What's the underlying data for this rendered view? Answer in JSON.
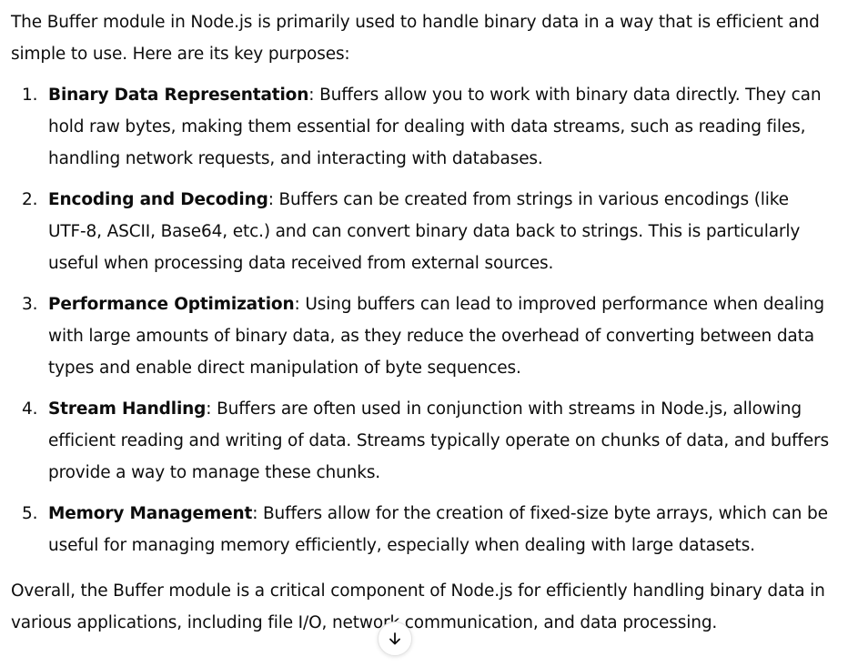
{
  "message": {
    "intro": "The Buffer module in Node.js is primarily used to handle binary data in a way that is efficient and simple to use. Here are its key purposes:",
    "items": [
      {
        "number": "1.",
        "title": "Binary Data Representation",
        "text": ": Buffers allow you to work with binary data directly. They can hold raw bytes, making them essential for dealing with data streams, such as reading files, handling network requests, and interacting with databases."
      },
      {
        "number": "2.",
        "title": "Encoding and Decoding",
        "text": ": Buffers can be created from strings in various encodings (like UTF-8, ASCII, Base64, etc.) and can convert binary data back to strings. This is particularly useful when processing data received from external sources."
      },
      {
        "number": "3.",
        "title": "Performance Optimization",
        "text": ": Using buffers can lead to improved performance when dealing with large amounts of binary data, as they reduce the overhead of converting between data types and enable direct manipulation of byte sequences."
      },
      {
        "number": "4.",
        "title": "Stream Handling",
        "text": ": Buffers are often used in conjunction with streams in Node.js, allowing efficient reading and writing of data. Streams typically operate on chunks of data, and buffers provide a way to manage these chunks."
      },
      {
        "number": "5.",
        "title": "Memory Management",
        "text": ": Buffers allow for the creation of fixed-size byte arrays, which can be useful for managing memory efficiently, especially when dealing with large datasets."
      }
    ],
    "outro": "Overall, the Buffer module is a critical component of Node.js for efficiently handling binary data in various applications, including file I/O, network communication, and data processing."
  },
  "scroll_button": {
    "icon": "arrow-down-icon"
  }
}
